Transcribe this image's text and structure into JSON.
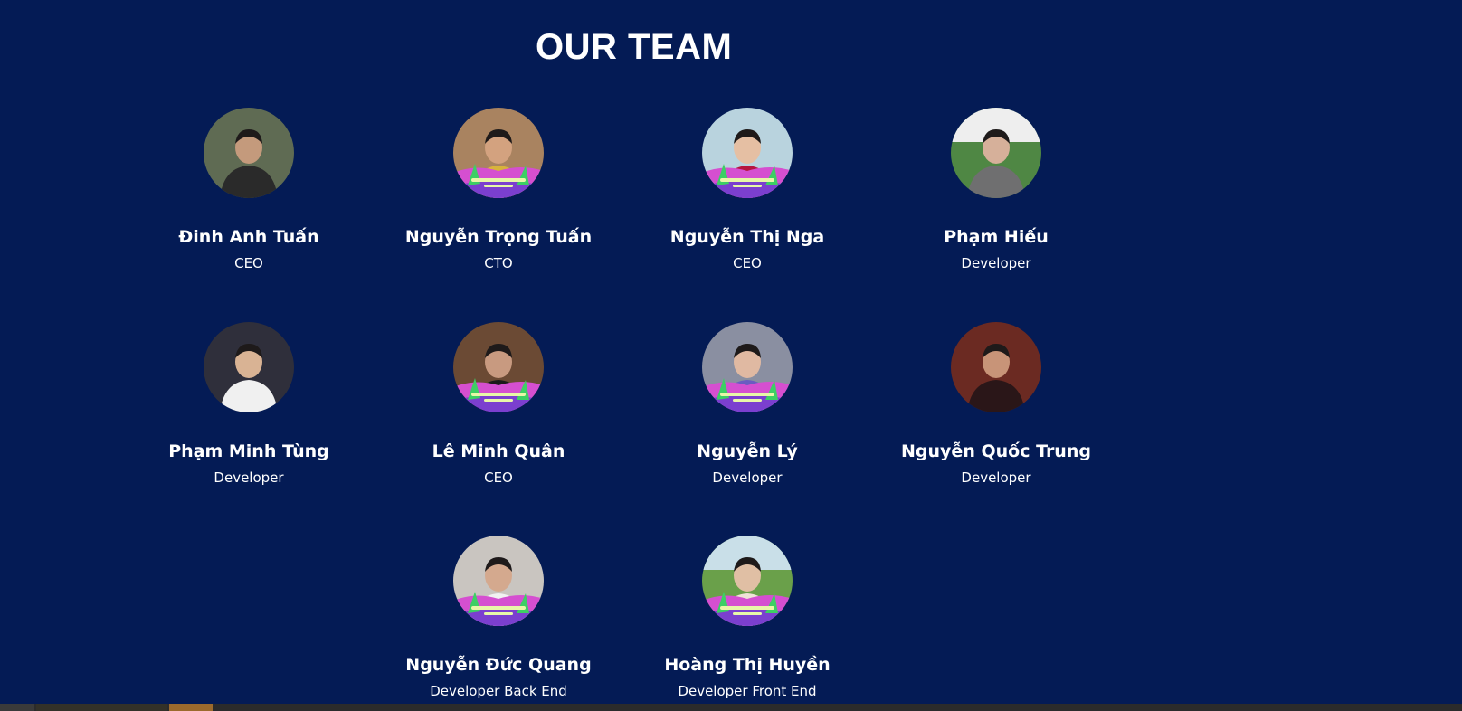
{
  "section": {
    "title": "OUR TEAM"
  },
  "members": [
    {
      "name": "Đinh Anh Tuấn",
      "role": "CEO",
      "avatar": {
        "type": "photo",
        "bg": "#5f6b53",
        "fg": "#2a2a2a",
        "skin": "#c49a7c"
      }
    },
    {
      "name": "Nguyễn Trọng Tuấn",
      "role": "CTO",
      "avatar": {
        "type": "frame",
        "bg": "#a98360",
        "fg": "#d8b33c",
        "skin": "#d3a27f"
      }
    },
    {
      "name": "Nguyễn Thị Nga",
      "role": "CEO",
      "avatar": {
        "type": "frame",
        "bg": "#b9d3de",
        "fg": "#b5163f",
        "skin": "#e5bfa3"
      }
    },
    {
      "name": "Phạm Hiếu",
      "role": "Developer",
      "avatar": {
        "type": "photo",
        "bg": "#4f8744",
        "fg": "#6f6f70",
        "skin": "#d6b09a",
        "sky": "#eeeeee"
      }
    },
    {
      "name": "Phạm Minh Tùng",
      "role": "Developer",
      "avatar": {
        "type": "photo",
        "bg": "#2f2f3b",
        "fg": "#f0f0f0",
        "skin": "#d9b394"
      }
    },
    {
      "name": "Lê Minh Quân",
      "role": "CEO",
      "avatar": {
        "type": "frame",
        "bg": "#6b4a34",
        "fg": "#1a1a1a",
        "skin": "#c89a80"
      }
    },
    {
      "name": "Nguyễn Lý",
      "role": "Developer",
      "avatar": {
        "type": "frame",
        "bg": "#8a8fa1",
        "fg": "#6a5cc1",
        "skin": "#e0b9a2"
      }
    },
    {
      "name": "Nguyễn Quốc Trung",
      "role": "Developer",
      "avatar": {
        "type": "photo",
        "bg": "#6b2a22",
        "fg": "#2a1618",
        "skin": "#c89478"
      }
    },
    {
      "name": "Nguyễn Đức Quang",
      "role": "Developer Back End",
      "avatar": {
        "type": "frame",
        "bg": "#c9c5c0",
        "fg": "#f1f1f1",
        "skin": "#d4a98e"
      }
    },
    {
      "name": "Hoàng Thị Huyền",
      "role": "Developer Front End",
      "avatar": {
        "type": "frame",
        "bg": "#6aa04a",
        "fg": "#efe3d6",
        "skin": "#e0bfa4",
        "sky": "#c9dfe8"
      }
    }
  ],
  "colors": {
    "background": "#041b55",
    "text": "#ffffff",
    "frame_pink": "#d54fd0",
    "frame_purple": "#7b3fcf",
    "frame_green": "#3dcf64"
  }
}
